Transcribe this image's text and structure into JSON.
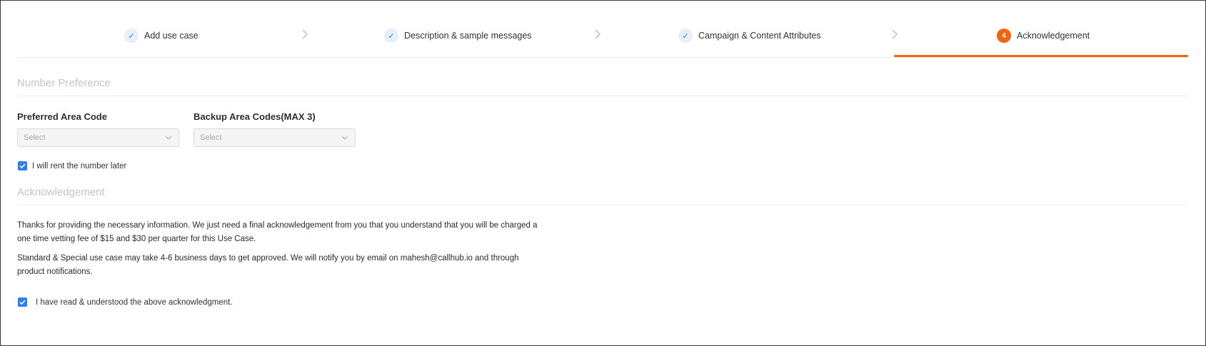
{
  "stepper": {
    "steps": [
      {
        "label": "Add use case",
        "state": "done",
        "icon": "check-icon"
      },
      {
        "label": "Description & sample messages",
        "state": "done",
        "icon": "check-icon"
      },
      {
        "label": "Campaign & Content Attributes",
        "state": "done",
        "icon": "check-icon"
      },
      {
        "label": "Acknowledgement",
        "state": "active",
        "number": "4"
      }
    ],
    "separator_icon": "chevron-right-icon",
    "accent_color": "#f2640f",
    "done_color": "#3a7bd5"
  },
  "number_preference": {
    "title": "Number Preference",
    "preferred_area_code": {
      "label": "Preferred Area Code",
      "placeholder": "Select"
    },
    "backup_area_codes": {
      "label": "Backup Area Codes(MAX 3)",
      "placeholder": "Select"
    },
    "rent_later": {
      "label": "I will rent the number later",
      "checked": true
    }
  },
  "acknowledgement": {
    "title": "Acknowledgement",
    "paragraph_1_line_1": "Thanks for providing the necessary information. We just need a final acknowledgement from you that you understand that you will be charged a",
    "paragraph_1_line_2": "one time vetting fee of $15 and $30 per quarter for this Use Case.",
    "paragraph_2_line_1": "Standard & Special use case may take 4-6 business days to get approved. We will notify you by email on mahesh@callhub.io and through",
    "paragraph_2_line_2": "product notifications.",
    "confirm": {
      "label": "I have read & understood the above acknowledgment.",
      "checked": true
    },
    "checkbox_color": "#2f80ed"
  }
}
